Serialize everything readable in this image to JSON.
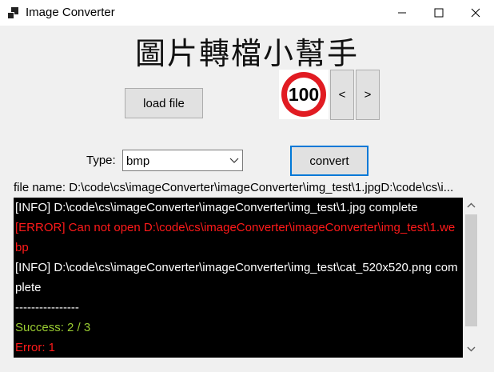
{
  "window": {
    "title": "Image Converter",
    "icon": "app-window-icon",
    "controls": [
      "minimize-icon",
      "maximize-icon",
      "close-icon"
    ]
  },
  "heading": "圖片轉檔小幫手",
  "buttons": {
    "load_file": "load file",
    "prev": "<",
    "next": ">",
    "convert": "convert"
  },
  "preview": {
    "sign_text": "100",
    "sign_colors": {
      "ring": "#e11b22",
      "face": "#ffffff",
      "text": "#000000"
    }
  },
  "type": {
    "label": "Type:",
    "selected": "bmp"
  },
  "file_name": "file name: D:\\code\\cs\\imageConverter\\imageConverter\\img_test\\1.jpgD:\\code\\cs\\i...",
  "log": {
    "lines": [
      {
        "text": "[INFO] D:\\code\\cs\\imageConverter\\imageConverter\\img_test\\1.jpg complete",
        "color": "#ffffff"
      },
      {
        "text": "[ERROR] Can not open D:\\code\\cs\\imageConverter\\imageConverter\\img_test\\1.webp",
        "color": "#ff1a1a"
      },
      {
        "text": "[INFO] D:\\code\\cs\\imageConverter\\imageConverter\\img_test\\cat_520x520.png complete",
        "color": "#ffffff"
      },
      {
        "text": "----------------",
        "color": "#ffffff"
      },
      {
        "text": "Success: 2 / 3",
        "color": "#9acd32"
      },
      {
        "text": "Error: 1",
        "color": "#ff1a1a"
      }
    ]
  },
  "colors": {
    "log_background": "#000000",
    "accent": "#0078d7",
    "window_background": "#f0f0f0"
  }
}
